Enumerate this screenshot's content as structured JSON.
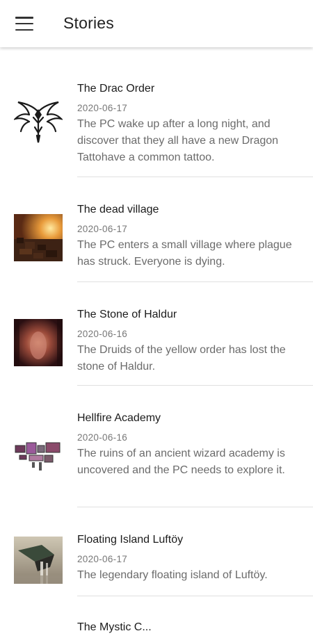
{
  "appbar": {
    "title": "Stories",
    "menu_icon": "hamburger-menu-icon"
  },
  "stories": [
    {
      "title": "The Drac Order",
      "date": "2020-06-17",
      "description": "The PC wake up after a long night, and discover that they all have a new Dragon Tattohave a common tattoo.",
      "thumb_icon": "dragon-tattoo-thumbnail"
    },
    {
      "title": "The dead village",
      "date": "2020-06-17",
      "description": "The PC enters a small village where plague has struck. Everyone is dying.",
      "thumb_icon": "burning-village-thumbnail"
    },
    {
      "title": "The Stone of Haldur",
      "date": "2020-06-16",
      "description": "The Druids of the yellow order has lost the stone of Haldur.",
      "thumb_icon": "glowing-stone-thumbnail"
    },
    {
      "title": "Hellfire Academy",
      "date": "2020-06-16",
      "description": "The ruins of an ancient wizard academy is uncovered and the PC needs to explore it.",
      "thumb_icon": "dungeon-map-thumbnail"
    },
    {
      "title": "Floating Island Luftöy",
      "date": "2020-06-17",
      "description": "The legendary floating island of Luftöy.",
      "thumb_icon": "floating-island-thumbnail"
    },
    {
      "title": "The Mystic C...",
      "date": "",
      "description": "",
      "thumb_icon": "partial-thumbnail"
    }
  ]
}
